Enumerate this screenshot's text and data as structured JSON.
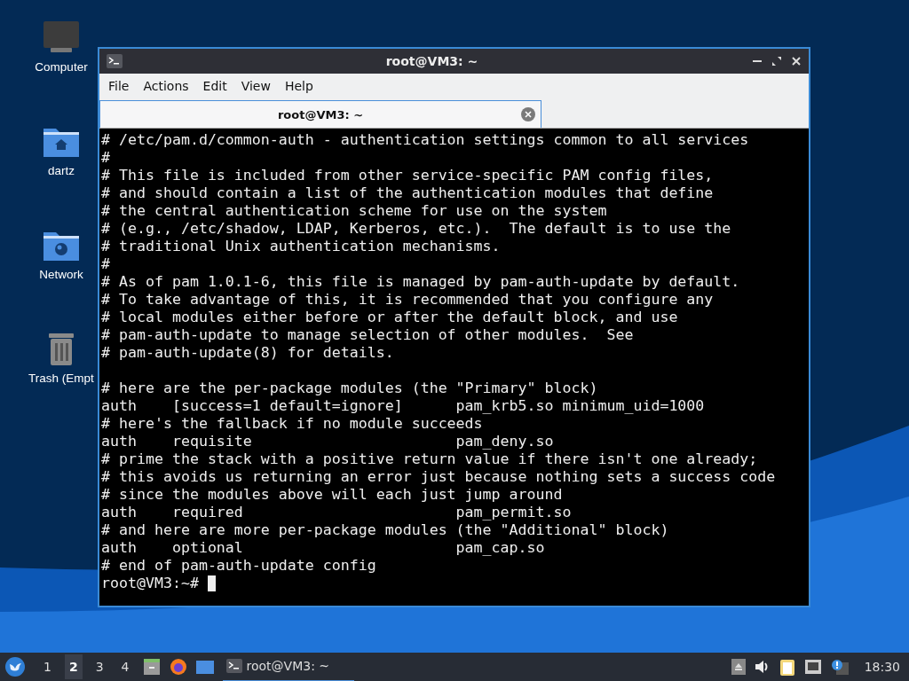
{
  "desktop_icons": [
    {
      "kind": "computer",
      "label": "Computer"
    },
    {
      "kind": "home",
      "label": "dartz"
    },
    {
      "kind": "network",
      "label": "Network"
    },
    {
      "kind": "trash",
      "label": "Trash (Empt"
    }
  ],
  "window": {
    "title": "root@VM3: ~",
    "menu": [
      "File",
      "Actions",
      "Edit",
      "View",
      "Help"
    ],
    "tabs": [
      {
        "label": "root@VM3: ~",
        "selected": true
      }
    ],
    "terminal": {
      "blocks": [
        [
          "# /etc/pam.d/common-auth - authentication settings common to all services",
          "#",
          "# This file is included from other service-specific PAM config files,",
          "# and should contain a list of the authentication modules that define",
          "# the central authentication scheme for use on the system",
          "# (e.g., /etc/shadow, LDAP, Kerberos, etc.).  The default is to use the",
          "# traditional Unix authentication mechanisms.",
          "#",
          "# As of pam 1.0.1-6, this file is managed by pam-auth-update by default.",
          "# To take advantage of this, it is recommended that you configure any",
          "# local modules either before or after the default block, and use",
          "# pam-auth-update to manage selection of other modules.  See",
          "# pam-auth-update(8) for details."
        ],
        [
          "# here are the per-package modules (the \"Primary\" block)",
          "auth    [success=1 default=ignore]      pam_krb5.so minimum_uid=1000",
          "# here's the fallback if no module succeeds",
          "auth    requisite                       pam_deny.so",
          "# prime the stack with a positive return value if there isn't one already;",
          "# this avoids us returning an error just because nothing sets a success code",
          "# since the modules above will each just jump around",
          "auth    required                        pam_permit.so",
          "# and here are more per-package modules (the \"Additional\" block)",
          "auth    optional                        pam_cap.so",
          "# end of pam-auth-update config"
        ]
      ],
      "prompt": "root@VM3:~#"
    }
  },
  "taskbar": {
    "workspaces": [
      {
        "label": "1",
        "selected": false
      },
      {
        "label": "2",
        "selected": true
      },
      {
        "label": "3",
        "selected": false
      },
      {
        "label": "4",
        "selected": false
      }
    ],
    "task": {
      "label": "root@VM3: ~",
      "selected": true
    },
    "clock": "18:30"
  }
}
